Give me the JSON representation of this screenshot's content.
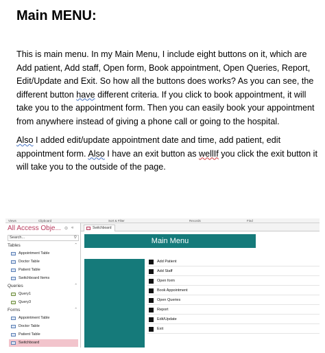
{
  "document": {
    "heading": "Main MENU:",
    "paragraph1": {
      "before_mark": "This is main menu. In my Main Menu, I include eight buttons on it, which are Add patient, Add staff, Open form, Book appointment, Open Queries, Report, Edit/Update and Exit. So how all the buttons does works? As you can see, the different button ",
      "marked": "have",
      "after_mark": " different criteria. If you click to book appointment, it will take you to the appointment form. Then you can easily book your appointment from anywhere instead of giving a phone call or going to the hospital."
    },
    "paragraph2": {
      "mark1": "Also",
      "mid1": " I added edit/update appointment date and time, add patient, edit appointment form. ",
      "mark2": "Also",
      "mid2": " I have an exit button as ",
      "mark3": "wellIf",
      "tail": " you click the exit button it will take you to the outside of the page."
    }
  },
  "access_screenshot": {
    "ribbon_labels": [
      "Views",
      "Clipboard",
      "Sort & Filter",
      "Records",
      "Find"
    ],
    "nav_pane": {
      "title": "All Access Obje...",
      "collapse_glyph": "«",
      "search_placeholder": "Search...",
      "groups": [
        {
          "label": "Tables",
          "items": [
            "Appointment Table",
            "Doctor Table",
            "Patient Table",
            "Switchboard Items"
          ]
        },
        {
          "label": "Queries",
          "items": [
            "Query1",
            "Query3"
          ]
        },
        {
          "label": "Forms",
          "items": [
            "Appointment Table",
            "Doctor Table",
            "Patient Table",
            "Switchboard"
          ]
        }
      ],
      "selected_item": "Switchboard"
    },
    "tab_label": "Switchboard",
    "form": {
      "banner_title": "Main Menu",
      "accent_color": "#157a7a",
      "buttons": [
        "Add Patient",
        "Add Staff",
        "Open form",
        "Book Appointment",
        "Open Queries",
        "Report",
        "Edit/Update",
        "Exit"
      ]
    }
  }
}
